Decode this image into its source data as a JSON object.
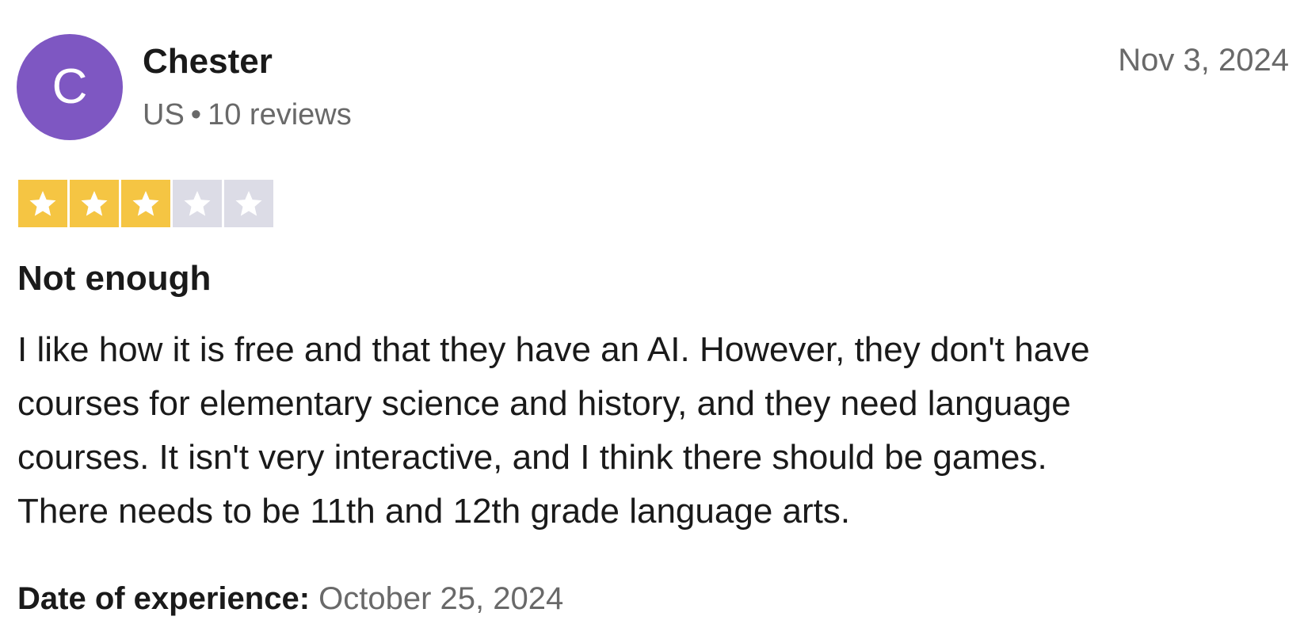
{
  "reviewer": {
    "initial": "C",
    "name": "Chester",
    "country": "US",
    "separator": "•",
    "review_count": "10 reviews",
    "avatar_color": "#7e57c2"
  },
  "review": {
    "date": "Nov 3, 2024",
    "rating": 3,
    "max_rating": 5,
    "star_filled_color": "#f5c543",
    "star_empty_color": "#dcdce6",
    "title": "Not enough",
    "body_lines": [
      "I like how it is free and that they have an AI. However, they don't have",
      "courses for elementary science and history, and they need language",
      "courses. It isn't very interactive, and I think there should be games.",
      "There needs to be 11th and 12th grade language arts."
    ],
    "experience_label": "Date of experience:",
    "experience_date": "October 25, 2024"
  }
}
